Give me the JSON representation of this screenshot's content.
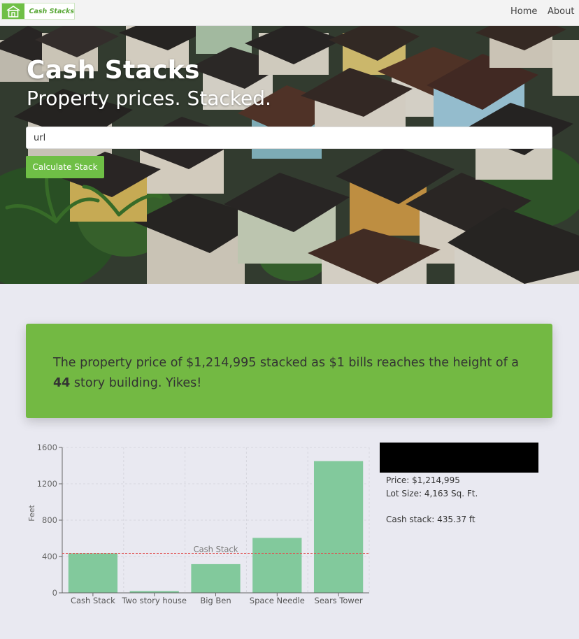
{
  "nav": {
    "logo_text": "Cash Stacks",
    "links": [
      "Home",
      "About"
    ]
  },
  "hero": {
    "title": "Cash Stacks",
    "subtitle": "Property prices. Stacked.",
    "input_value": "url",
    "button_label": "Calculate Stack"
  },
  "result": {
    "text_before": "The property price of $1,214,995 stacked as $1 bills reaches the height of a ",
    "stories": "44",
    "text_after": " story building. Yikes!"
  },
  "info": {
    "price": "Price: $1,214,995",
    "lot_size": "Lot Size: 4,163 Sq. Ft.",
    "cash_stack": "Cash stack: 435.37 ft"
  },
  "colors": {
    "accent_green": "#6fbf46",
    "bar_green": "#82c99c",
    "reference_line": "#e05050"
  },
  "chart_data": {
    "type": "bar",
    "categories": [
      "Cash Stack",
      "Two story house",
      "Big Ben",
      "Space Needle",
      "Sears Tower"
    ],
    "values": [
      435,
      20,
      316,
      605,
      1450
    ],
    "ylabel": "Feet",
    "xlabel": "",
    "ylim": [
      0,
      1600
    ],
    "yticks": [
      0,
      400,
      800,
      1200,
      1600
    ],
    "grid": true,
    "reference_line": {
      "value": 435,
      "label": "Cash Stack"
    }
  }
}
